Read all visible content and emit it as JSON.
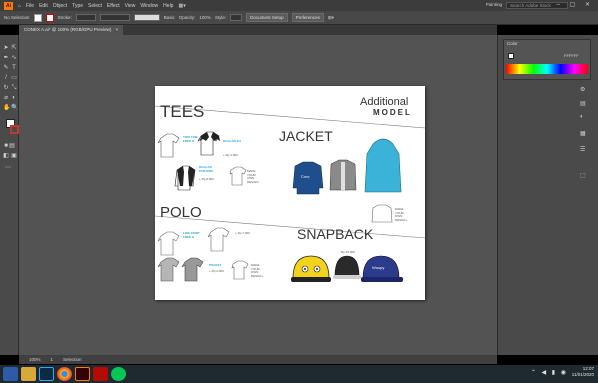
{
  "menubar": {
    "logo": "Ai",
    "items": [
      "File",
      "Edit",
      "Object",
      "Type",
      "Select",
      "Effect",
      "View",
      "Window",
      "Help"
    ],
    "workspace": "Painting",
    "search_placeholder": "Search Adobe Stock",
    "window_controls": "– ▢ ✕"
  },
  "controlbar": {
    "no_selection": "No Selection",
    "stroke_label": "Stroke:",
    "uniform": "Basic",
    "opacity_label": "Opacity:",
    "opacity_value": "100%",
    "style_label": "Style:",
    "document_setup": "Document Setup",
    "preferences": "Preferences"
  },
  "document_tab": {
    "title": "CONEX A.ai* @ 100% (RGB/GPU Preview)",
    "close": "×"
  },
  "artboard": {
    "tees_title": "TEES",
    "additional_line1": "Additional",
    "additional_line2": "MODEL",
    "jacket_title": "JACKET",
    "polo_title": "POLO",
    "snapback_title": "SNAPBACK",
    "make_your_own_design": "MAKE YOUR OWN DESIGN",
    "labels": {
      "two_line_free_h": "TWO LINE FREE H",
      "raglan_3_4": "RAGLAN 3/4",
      "raglan_panjang": "RAGLAN PANJANG",
      "line_strip_free_h": "LINE STRIP FREE H",
      "pocket": "POCKET",
      "rp_45000": "Rp 45.000",
      "rp_4000": "+ Rp 4.000",
      "rp_8000": "+ Rp 8.000",
      "rp_7000": "+ Rp 7.000",
      "rp_2000": "+ Rp 2.000"
    },
    "cap_text": "Woopy"
  },
  "colorpanel": {
    "title": "Color",
    "hex": "FFFFFF"
  },
  "statusbar": {
    "zoom": "100%",
    "artboard_num": "1",
    "tool": "Selection"
  },
  "taskbar": {
    "clock_time": "12:07",
    "clock_date": "11/01/2020"
  },
  "colors": {
    "ai_orange": "#FF7C00",
    "accent_blue": "#29A8D8",
    "canvas": "#535353"
  }
}
